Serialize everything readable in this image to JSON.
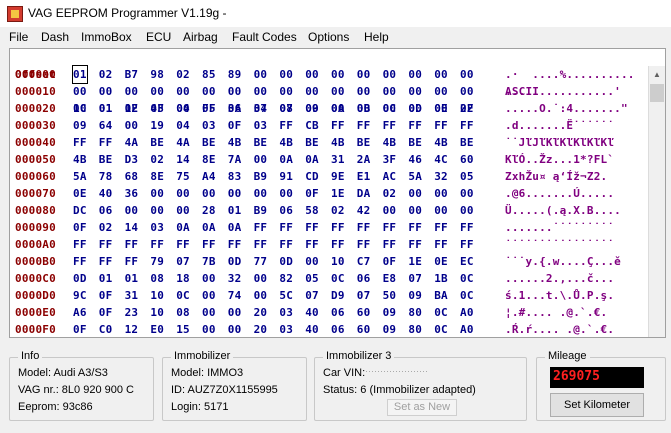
{
  "window": {
    "title": "VAG EEPROM Programmer  V1.19g -"
  },
  "menu": [
    "File",
    "Dash",
    "ImmoBox",
    "ECU",
    "Airbag",
    "Fault Codes",
    "Options",
    "Help"
  ],
  "hex": {
    "offset_label": "Offset",
    "ascii_label": "ASCII",
    "columns": [
      "00",
      "01",
      "02",
      "03",
      "04",
      "05",
      "06",
      "07",
      "08",
      "09",
      "0A",
      "0B",
      "0C",
      "0D",
      "0E",
      "0F"
    ],
    "rows": [
      {
        "addr": "000000",
        "bytes": [
          "01",
          "02",
          "B7",
          "98",
          "02",
          "85",
          "89",
          "00",
          "00",
          "00",
          "00",
          "00",
          "00",
          "00",
          "00",
          "00"
        ],
        "ascii": ".·  ....%.........."
      },
      {
        "addr": "000010",
        "bytes": [
          "00",
          "00",
          "00",
          "00",
          "00",
          "00",
          "00",
          "00",
          "00",
          "00",
          "00",
          "00",
          "00",
          "00",
          "00",
          "00"
        ],
        "ascii": "................'"
      },
      {
        "addr": "000020",
        "bytes": [
          "1C",
          "01",
          "1E",
          "4F",
          "00",
          "FF",
          "3A",
          "34",
          "07",
          "00",
          "00",
          "00",
          "00",
          "00",
          "00",
          "22"
        ],
        "ascii": ".....O.˙:4.......\""
      },
      {
        "addr": "000030",
        "bytes": [
          "09",
          "64",
          "00",
          "19",
          "04",
          "03",
          "0F",
          "03",
          "FF",
          "CB",
          "FF",
          "FF",
          "FF",
          "FF",
          "FF",
          "FF"
        ],
        "ascii": ".d.......Ë˙˙˙˙˙˙"
      },
      {
        "addr": "000040",
        "bytes": [
          "FF",
          "FF",
          "4A",
          "BE",
          "4A",
          "BE",
          "4B",
          "BE",
          "4B",
          "BE",
          "4B",
          "BE",
          "4B",
          "BE",
          "4B",
          "BE"
        ],
        "ascii": "˙˙JľJľKľKľKľKľKľ"
      },
      {
        "addr": "000050",
        "bytes": [
          "4B",
          "BE",
          "D3",
          "02",
          "14",
          "8E",
          "7A",
          "00",
          "0A",
          "0A",
          "31",
          "2A",
          "3F",
          "46",
          "4C",
          "60"
        ],
        "ascii": "KľÓ..Žz...1*?FL`"
      },
      {
        "addr": "000060",
        "bytes": [
          "5A",
          "78",
          "68",
          "8E",
          "75",
          "A4",
          "83",
          "B9",
          "91",
          "CD",
          "9E",
          "E1",
          "AC",
          "5A",
          "32",
          "05"
        ],
        "ascii": "ZxhŽu¤ ą‘Íž¬Z2."
      },
      {
        "addr": "000070",
        "bytes": [
          "0E",
          "40",
          "36",
          "00",
          "00",
          "00",
          "00",
          "00",
          "00",
          "0F",
          "1E",
          "DA",
          "02",
          "00",
          "00",
          "00"
        ],
        "ascii": ".@6.......Ú....."
      },
      {
        "addr": "000080",
        "bytes": [
          "DC",
          "06",
          "00",
          "00",
          "00",
          "28",
          "01",
          "B9",
          "06",
          "58",
          "02",
          "42",
          "00",
          "00",
          "00",
          "00"
        ],
        "ascii": "Ü.....(.ą.X.B...."
      },
      {
        "addr": "000090",
        "bytes": [
          "0F",
          "02",
          "14",
          "03",
          "0A",
          "0A",
          "0A",
          "FF",
          "FF",
          "FF",
          "FF",
          "FF",
          "FF",
          "FF",
          "FF",
          "FF"
        ],
        "ascii": ".......˙˙˙˙˙˙˙˙˙"
      },
      {
        "addr": "0000A0",
        "bytes": [
          "FF",
          "FF",
          "FF",
          "FF",
          "FF",
          "FF",
          "FF",
          "FF",
          "FF",
          "FF",
          "FF",
          "FF",
          "FF",
          "FF",
          "FF",
          "FF"
        ],
        "ascii": "˙˙˙˙˙˙˙˙˙˙˙˙˙˙˙˙"
      },
      {
        "addr": "0000B0",
        "bytes": [
          "FF",
          "FF",
          "FF",
          "79",
          "07",
          "7B",
          "0D",
          "77",
          "0D",
          "00",
          "10",
          "C7",
          "0F",
          "1E",
          "0E",
          "EC"
        ],
        "ascii": "˙˙˙y.{.w....Ç...ě"
      },
      {
        "addr": "0000C0",
        "bytes": [
          "0D",
          "01",
          "01",
          "08",
          "18",
          "00",
          "32",
          "00",
          "82",
          "05",
          "0C",
          "06",
          "E8",
          "07",
          "1B",
          "0C"
        ],
        "ascii": "......2.‚...č..."
      },
      {
        "addr": "0000D0",
        "bytes": [
          "9C",
          "0F",
          "31",
          "10",
          "0C",
          "00",
          "74",
          "00",
          "5C",
          "07",
          "D9",
          "07",
          "50",
          "09",
          "BA",
          "0C"
        ],
        "ascii": "ś.1...t.\\.Ů.P.ş."
      },
      {
        "addr": "0000E0",
        "bytes": [
          "A6",
          "0F",
          "23",
          "10",
          "08",
          "00",
          "00",
          "20",
          "03",
          "40",
          "06",
          "60",
          "09",
          "80",
          "0C",
          "A0"
        ],
        "ascii": "¦.#.... .@.`.€. "
      },
      {
        "addr": "0000F0",
        "bytes": [
          "0F",
          "C0",
          "12",
          "E0",
          "15",
          "00",
          "00",
          "20",
          "03",
          "40",
          "06",
          "60",
          "09",
          "80",
          "0C",
          "A0"
        ],
        "ascii": ".Ŕ.ŕ.... .@.`.€. "
      }
    ]
  },
  "info": {
    "title": "Info",
    "model": "Model:  Audi A3/S3",
    "vag_nr": "VAG nr.: 8L0 920 900 C",
    "eeprom": "Eeprom: 93c86"
  },
  "immobilizer": {
    "title": "Immobilizer",
    "model": "Model:  IMMO3",
    "id": "ID: AUZ7Z0X1155995",
    "login": "Login: 5171"
  },
  "immobilizer3": {
    "title": "Immobilizer 3",
    "car_vin": "Car VIN:",
    "status": "Status: 6 (Immobilizer adapted)",
    "set_as_new": "Set as New"
  },
  "mileage": {
    "title": "Mileage",
    "value": "269075",
    "set_button": "Set Kilometer"
  },
  "colors": {
    "address": "#8b0000",
    "bytes": "#00008b",
    "ascii": "#800080",
    "mileage_text": "#ff2020"
  }
}
